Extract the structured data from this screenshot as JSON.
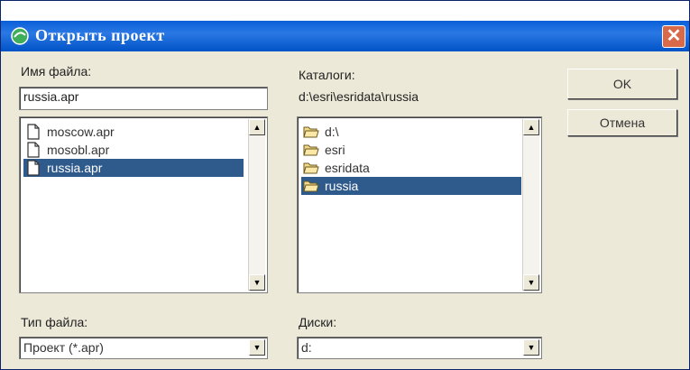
{
  "dialog": {
    "title": "Открыть проект",
    "close_glyph": "✕",
    "title_icon": "arcview-project-icon"
  },
  "file_name": {
    "label": "Имя файла:",
    "value": "russia.apr"
  },
  "file_list": {
    "items": [
      {
        "label": "moscow.apr",
        "selected": false,
        "icon": "file-icon"
      },
      {
        "label": "mosobl.apr",
        "selected": false,
        "icon": "file-icon"
      },
      {
        "label": "russia.apr",
        "selected": true,
        "icon": "file-icon"
      }
    ]
  },
  "directory": {
    "label": "Каталоги:",
    "path": "d:\\esri\\esridata\\russia",
    "items": [
      {
        "label": "d:\\",
        "selected": false,
        "icon": "folder-open-icon"
      },
      {
        "label": "esri",
        "selected": false,
        "icon": "folder-open-icon"
      },
      {
        "label": "esridata",
        "selected": false,
        "icon": "folder-open-icon"
      },
      {
        "label": "russia",
        "selected": true,
        "icon": "folder-open-icon"
      }
    ]
  },
  "buttons": {
    "ok": "OK",
    "cancel": "Отмена"
  },
  "file_type": {
    "label": "Тип файла:",
    "value": "Проект (*.apr)"
  },
  "drives": {
    "label": "Диски:",
    "value": "d:"
  },
  "scroll_glyphs": {
    "up": "▲",
    "down": "▼"
  }
}
